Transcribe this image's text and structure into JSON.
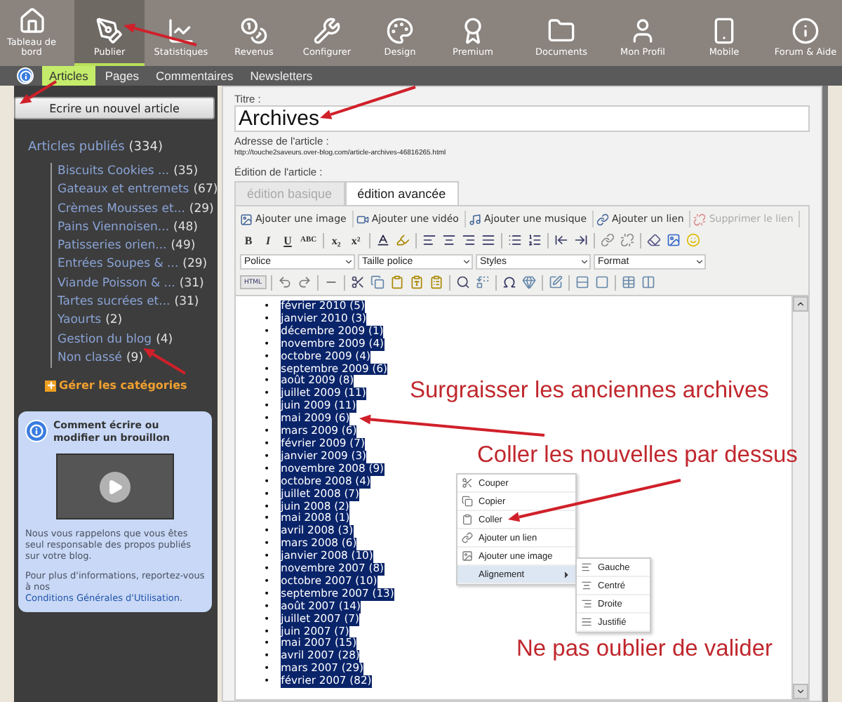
{
  "nav_main": [
    {
      "label": "Tableau de bord",
      "selected": false
    },
    {
      "label": "Publier",
      "selected": true
    },
    {
      "label": "Statistiques",
      "selected": false
    },
    {
      "label": "Revenus",
      "selected": false
    },
    {
      "label": "Configurer",
      "selected": false
    },
    {
      "label": "Design",
      "selected": false
    },
    {
      "label": "Premium",
      "selected": false
    }
  ],
  "nav_secondary": [
    {
      "label": "Documents",
      "selected": false
    },
    {
      "label": "Mon Profil",
      "selected": false
    },
    {
      "label": "Mobile",
      "selected": false
    },
    {
      "label": "Forum & Aide",
      "selected": false
    }
  ],
  "subnav": [
    {
      "label": "Articles",
      "selected": true
    },
    {
      "label": "Pages",
      "selected": false
    },
    {
      "label": "Commentaires",
      "selected": false
    },
    {
      "label": "Newsletters",
      "selected": false
    }
  ],
  "sidebar": {
    "new_button": "Ecrire un nouvel article",
    "published": {
      "label": "Articles publiés",
      "count": "(334)"
    },
    "categories": [
      {
        "label": "Biscuits Cookies ...",
        "count": "(35)"
      },
      {
        "label": "Gateaux et entremets",
        "count": "(67)"
      },
      {
        "label": "Crèmes Mousses et...",
        "count": "(29)"
      },
      {
        "label": "Pains Viennoisen...",
        "count": "(48)"
      },
      {
        "label": "Patisseries orien...",
        "count": "(49)"
      },
      {
        "label": "Entrées Soupes & ...",
        "count": "(29)"
      },
      {
        "label": "Viande Poisson & ...",
        "count": "(31)"
      },
      {
        "label": "Tartes sucrées et...",
        "count": "(31)"
      },
      {
        "label": "Yaourts",
        "count": "(2)"
      },
      {
        "label": "Gestion du blog",
        "count": "(4)"
      },
      {
        "label": "Non classé",
        "count": "(9)"
      }
    ],
    "manage": "Gérer les catégories",
    "help": {
      "title": "Comment écrire ou modifier un brouillon",
      "notice": "Nous vous rappelons que vous êtes seul responsable des propos publiés sur votre blog.",
      "more_before": "Pour plus d'informations, reportez-vous à nos",
      "more_link": "Conditions Générales d'Utilisation",
      "more_after": "."
    }
  },
  "form": {
    "title_label": "Titre :",
    "title_value": "Archives",
    "address_label": "Adresse de l'article :",
    "address": "http://touche2saveurs.over-blog.com/article-archives-46816265.html",
    "edit_label": "Édition de l'article :"
  },
  "editor": {
    "tabs": [
      {
        "label": "édition basique",
        "selected": false
      },
      {
        "label": "édition avancée",
        "selected": true
      }
    ],
    "insert_buttons": [
      {
        "label": "Ajouter une image",
        "disabled": false
      },
      {
        "label": "Ajouter une vidéo",
        "disabled": false
      },
      {
        "label": "Ajouter une musique",
        "disabled": false
      },
      {
        "label": "Ajouter un lien",
        "disabled": false
      },
      {
        "label": "Supprimer le lien",
        "disabled": true
      }
    ],
    "format_glyphs": [
      "B",
      "I",
      "U",
      "ABC",
      "x₂",
      "x²"
    ],
    "dropdowns": [
      "Police",
      "Taille police",
      "Styles",
      "Format"
    ],
    "html_button": "HTML",
    "content": {
      "selected": true,
      "bullet": "•",
      "items": [
        "février 2010 (5)",
        "janvier 2010 (3)",
        "décembre 2009 (1)",
        "novembre 2009 (4)",
        "octobre 2009 (4)",
        "septembre 2009 (6)",
        "août 2009 (8)",
        "juillet 2009 (11)",
        "juin 2009 (11)",
        "mai 2009 (6)",
        "mars 2009 (6)",
        "février 2009 (7)",
        "janvier 2009 (3)",
        "novembre 2008 (9)",
        "octobre 2008 (4)",
        "juillet 2008 (7)",
        "juin 2008 (2)",
        "mai 2008 (1)",
        "avril 2008 (3)",
        "mars 2008 (6)",
        "janvier 2008 (10)",
        "novembre 2007 (8)",
        "octobre 2007 (10)",
        "septembre 2007 (13)",
        "août 2007 (14)",
        "juillet 2007 (7)",
        "juin 2007 (7)",
        "mai 2007 (15)",
        "avril 2007 (28)",
        "mars 2007 (29)",
        "février 2007 (82)"
      ]
    },
    "context_menu": [
      {
        "label": "Couper",
        "highlighted": false,
        "submenu": false
      },
      {
        "label": "Copier",
        "highlighted": false,
        "submenu": false
      },
      {
        "label": "Coller",
        "highlighted": false,
        "submenu": false
      },
      {
        "label": "Ajouter un lien",
        "highlighted": false,
        "submenu": false
      },
      {
        "label": "Ajouter une image",
        "highlighted": false,
        "submenu": false
      },
      {
        "label": "Alignement",
        "highlighted": true,
        "submenu": true
      }
    ],
    "submenu": [
      "Gauche",
      "Centré",
      "Droite",
      "Justifié"
    ]
  },
  "annotations": [
    "Surgraisser les anciennes archives",
    "Coller les nouvelles par dessus",
    "Ne pas oublier de valider"
  ]
}
